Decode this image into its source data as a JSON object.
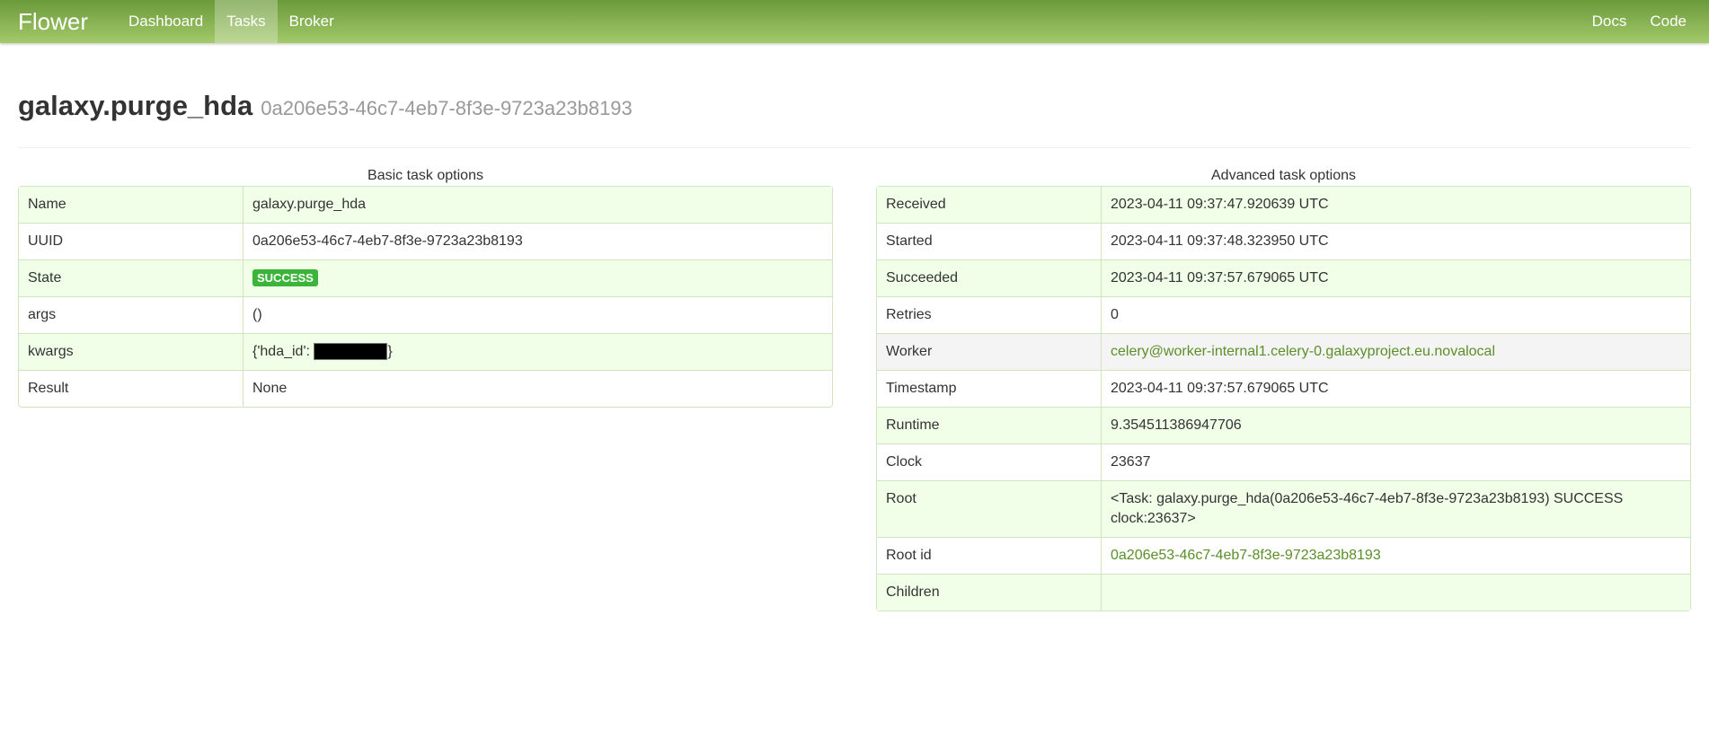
{
  "nav": {
    "brand": "Flower",
    "left": [
      "Dashboard",
      "Tasks",
      "Broker"
    ],
    "right": [
      "Docs",
      "Code"
    ],
    "active": "Tasks"
  },
  "header": {
    "title": "galaxy.purge_hda",
    "uuid": "0a206e53-46c7-4eb7-8f3e-9723a23b8193"
  },
  "basic": {
    "caption": "Basic task options",
    "rows": {
      "name": {
        "key": "Name",
        "value": "galaxy.purge_hda"
      },
      "uuid": {
        "key": "UUID",
        "value": "0a206e53-46c7-4eb7-8f3e-9723a23b8193"
      },
      "state": {
        "key": "State",
        "value": "SUCCESS"
      },
      "args": {
        "key": "args",
        "value": "()"
      },
      "kwargs": {
        "key": "kwargs",
        "prefix": "{'hda_id': ",
        "suffix": "}"
      },
      "result": {
        "key": "Result",
        "value": "None"
      }
    }
  },
  "advanced": {
    "caption": "Advanced task options",
    "rows": {
      "received": {
        "key": "Received",
        "value": "2023-04-11 09:37:47.920639 UTC"
      },
      "started": {
        "key": "Started",
        "value": "2023-04-11 09:37:48.323950 UTC"
      },
      "succeeded": {
        "key": "Succeeded",
        "value": "2023-04-11 09:37:57.679065 UTC"
      },
      "retries": {
        "key": "Retries",
        "value": "0"
      },
      "worker": {
        "key": "Worker",
        "value": "celery@worker-internal1.celery-0.galaxyproject.eu.novalocal"
      },
      "timestamp": {
        "key": "Timestamp",
        "value": "2023-04-11 09:37:57.679065 UTC"
      },
      "runtime": {
        "key": "Runtime",
        "value": "9.354511386947706"
      },
      "clock": {
        "key": "Clock",
        "value": "23637"
      },
      "root": {
        "key": "Root",
        "value": "<Task: galaxy.purge_hda(0a206e53-46c7-4eb7-8f3e-9723a23b8193) SUCCESS clock:23637>"
      },
      "root_id": {
        "key": "Root id",
        "value": "0a206e53-46c7-4eb7-8f3e-9723a23b8193"
      },
      "children": {
        "key": "Children",
        "value": ""
      }
    }
  },
  "colors": {
    "accent": "#6b9a3a",
    "link": "#5a8f29",
    "success": "#3ab53a",
    "row_stripe": "#f1ffe8"
  }
}
